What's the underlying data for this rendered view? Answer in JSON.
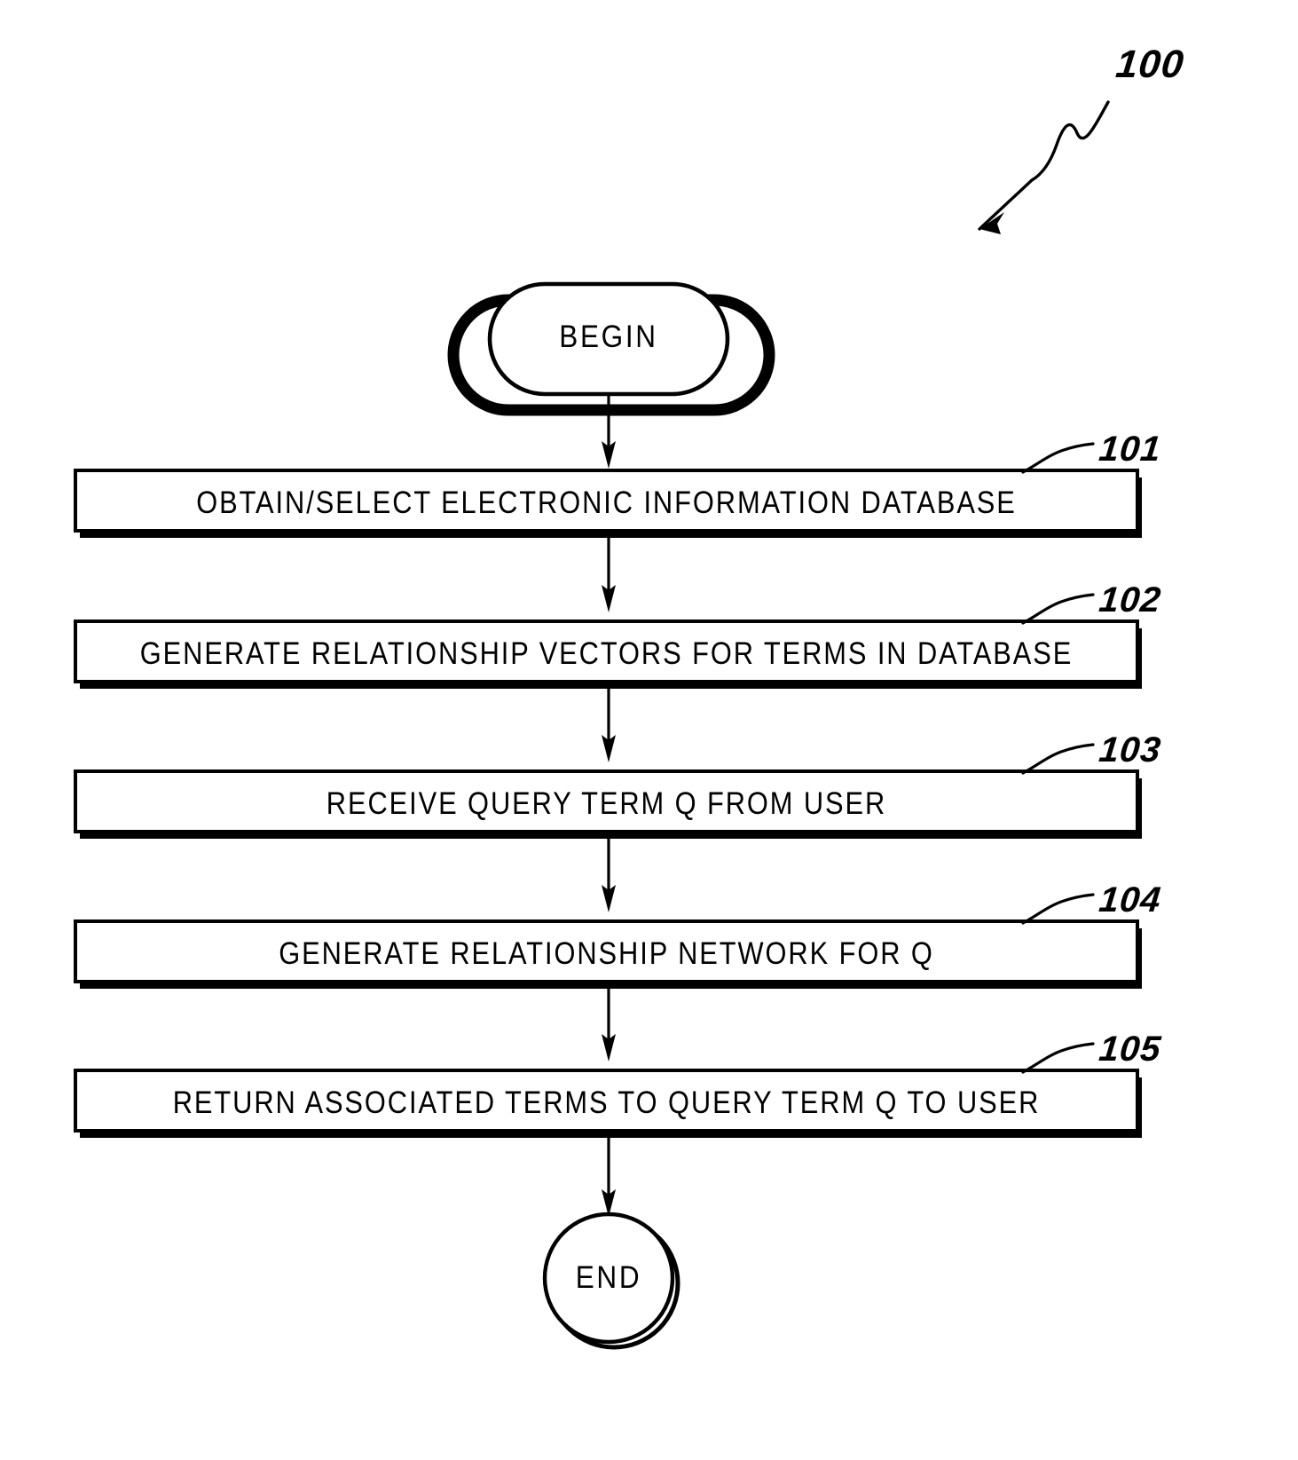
{
  "figure": {
    "main_reference": "100",
    "type": "patent-flowchart"
  },
  "nodes": {
    "begin": {
      "label": "BEGIN",
      "shape": "stadium"
    },
    "end": {
      "label": "END",
      "shape": "circle"
    }
  },
  "steps": [
    {
      "ref": "101",
      "label": "OBTAIN/SELECT ELECTRONIC INFORMATION DATABASE"
    },
    {
      "ref": "102",
      "label": "GENERATE RELATIONSHIP VECTORS FOR TERMS IN DATABASE"
    },
    {
      "ref": "103",
      "label": "RECEIVE QUERY TERM Q FROM USER"
    },
    {
      "ref": "104",
      "label": "GENERATE RELATIONSHIP NETWORK FOR Q"
    },
    {
      "ref": "105",
      "label": "RETURN ASSOCIATED TERMS TO QUERY TERM Q TO USER"
    }
  ],
  "colors": {
    "ink": "#000000",
    "paper": "#ffffff"
  }
}
